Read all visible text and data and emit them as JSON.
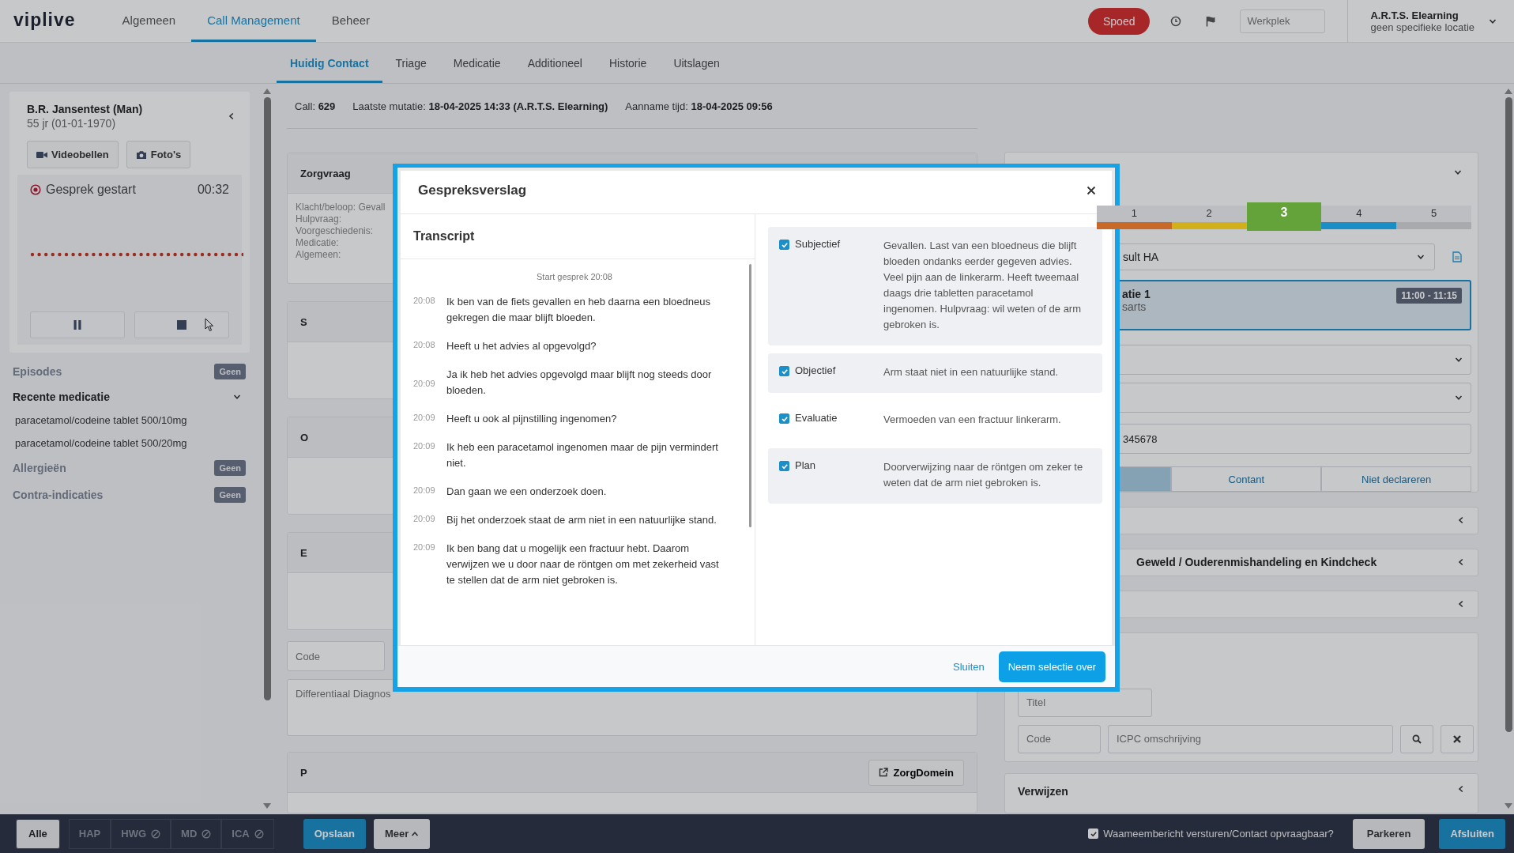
{
  "top_nav": {
    "logo": "viplive",
    "items": [
      {
        "label": "Algemeen",
        "selected": false
      },
      {
        "label": "Call Management",
        "selected": true
      },
      {
        "label": "Beheer",
        "selected": false
      }
    ],
    "urgent_button": "Spoed",
    "workplace_field": {
      "placeholder": "Werkplek"
    },
    "user": {
      "name": "A.R.T.S. Elearning",
      "location": "geen specifieke locatie"
    }
  },
  "sub_tabs": [
    {
      "label": "Huidig Contact",
      "selected": true
    },
    {
      "label": "Triage",
      "selected": false
    },
    {
      "label": "Medicatie",
      "selected": false
    },
    {
      "label": "Additioneel",
      "selected": false
    },
    {
      "label": "Historie",
      "selected": false
    },
    {
      "label": "Uitslagen",
      "selected": false
    }
  ],
  "patient": {
    "name": "B.R. Jansentest (Man)",
    "age": "55 jr (01-01-1970)",
    "video_button": "Videobellen",
    "photo_button": "Foto's",
    "call_status": "Gesprek gestart",
    "call_timer": "00:32"
  },
  "sidebar_sections": [
    {
      "kind": "badge",
      "title": "Episodes",
      "badge": "Geen"
    },
    {
      "kind": "list",
      "title": "Recente medicatie",
      "expanded": true,
      "items": [
        "paracetamol/codeine tablet 500/10mg",
        "paracetamol/codeine tablet 500/20mg"
      ]
    },
    {
      "kind": "badge",
      "title": "Allergieën",
      "badge": "Geen"
    },
    {
      "kind": "badge",
      "title": "Contra-indicaties",
      "badge": "Geen"
    }
  ],
  "call_info": [
    {
      "label": "Call:",
      "value": "629"
    },
    {
      "label": "Laatste mutatie:",
      "value": "18-04-2025 14:33 (A.R.T.S. Elearning)"
    },
    {
      "label": "Aanname tijd:",
      "value": "18-04-2025 09:56"
    }
  ],
  "zorgvraag": {
    "title": "Zorgvraag",
    "lines": [
      "Klacht/beloop: Gevall",
      "Hulpvraag:",
      "Voorgeschiedenis:",
      "Medicatie:",
      "Algemeen:"
    ]
  },
  "soep_sections": [
    "S",
    "O",
    "E"
  ],
  "code_field": {
    "placeholder": "Code"
  },
  "diagnosis_field": {
    "placeholder": "Differentiaal Diagnos"
  },
  "plan_section": {
    "title": "P",
    "button": "ZorgDomein"
  },
  "urgency": [
    {
      "label": "1",
      "color": "#c8692a",
      "selected": false
    },
    {
      "label": "2",
      "color": "#d2b01c",
      "selected": false
    },
    {
      "label": "3",
      "color": "#64a23a",
      "selected": true
    },
    {
      "label": "4",
      "color": "#1a8ec6",
      "selected": false
    },
    {
      "label": "5",
      "color": "#a9aaad",
      "selected": false
    }
  ],
  "consult_select": "sult HA",
  "appointment": {
    "title": "atie 1",
    "subtitle": "sarts",
    "time": "11:00 - 11:15"
  },
  "phone_value": "345678",
  "payment_options": [
    {
      "selected": true
    },
    {
      "label": "Contant",
      "selected": false
    },
    {
      "label": "Niet declareren",
      "selected": false
    }
  ],
  "collapsed_panels": [
    {
      "kind": "untitled"
    },
    {
      "kind": "titled",
      "title": "Geweld / Ouderenmishandeling en Kindcheck"
    },
    {
      "kind": "untitled"
    }
  ],
  "diagnosis_search": {
    "title_placeholder": "Titel",
    "code_placeholder": "Code",
    "description_placeholder": "ICPC omschrijving"
  },
  "referral_panel": "Verwijzen",
  "bottom_bar": {
    "filters": [
      {
        "label": "Alle",
        "selected": true,
        "blocked": false
      },
      {
        "label": "HAP",
        "selected": false,
        "blocked": false
      },
      {
        "label": "HWG",
        "selected": false,
        "blocked": true
      },
      {
        "label": "MD",
        "selected": false,
        "blocked": true
      },
      {
        "label": "ICA",
        "selected": false,
        "blocked": true
      }
    ],
    "save_button": "Opslaan",
    "more_button": "Meer",
    "notify": {
      "label": "Waameembericht versturen/Contact opvraagbaar?",
      "checked": true
    },
    "park_button": "Parkeren",
    "close_button": "Afsluiten"
  },
  "modal": {
    "title": "Gespreksverslag",
    "transcript_title": "Transcript",
    "start_label": "Start gesprek 20:08",
    "messages": [
      {
        "time": "20:08",
        "text": "Ik ben van de fiets gevallen en heb daarna een bloedneus gekregen die maar blijft bloeden."
      },
      {
        "time": "20:08",
        "text": "Heeft u het advies al opgevolgd?"
      },
      {
        "time": "20:09",
        "text": "Ja ik heb het advies opgevolgd maar blijft nog steeds door bloeden."
      },
      {
        "time": "20:09",
        "text": "Heeft u ook al pijnstilling ingenomen?"
      },
      {
        "time": "20:09",
        "text": "Ik heb een paracetamol ingenomen maar de pijn vermindert niet."
      },
      {
        "time": "20:09",
        "text": "Dan gaan we een onderzoek doen."
      },
      {
        "time": "20:09",
        "text": "Bij het onderzoek staat de arm niet in een natuurlijke stand."
      },
      {
        "time": "20:09",
        "text": "Ik ben bang dat u mogelijk een fractuur hebt. Daarom verwijzen we u door naar de röntgen om met zekerheid vast te stellen dat de arm niet gebroken is."
      }
    ],
    "sections": [
      {
        "label": "Subjectief",
        "checked": true,
        "highlighted": true,
        "text": "Gevallen. Last van een bloedneus die blijft bloeden ondanks eerder gegeven advies. Veel pijn aan de linkerarm. Heeft tweemaal daags drie tabletten paracetamol ingenomen. Hulpvraag: wil weten of de arm gebroken is."
      },
      {
        "label": "Objectief",
        "checked": true,
        "highlighted": true,
        "text": "Arm staat niet in een natuurlijke stand."
      },
      {
        "label": "Evaluatie",
        "checked": true,
        "highlighted": false,
        "text": "Vermoeden van een fractuur linkerarm."
      },
      {
        "label": "Plan",
        "checked": true,
        "highlighted": true,
        "text": "Doorverwijzing naar de röntgen om zeker te weten dat de arm niet gebroken is."
      }
    ],
    "cancel_button": "Sluiten",
    "confirm_button": "Neem selectie over"
  }
}
